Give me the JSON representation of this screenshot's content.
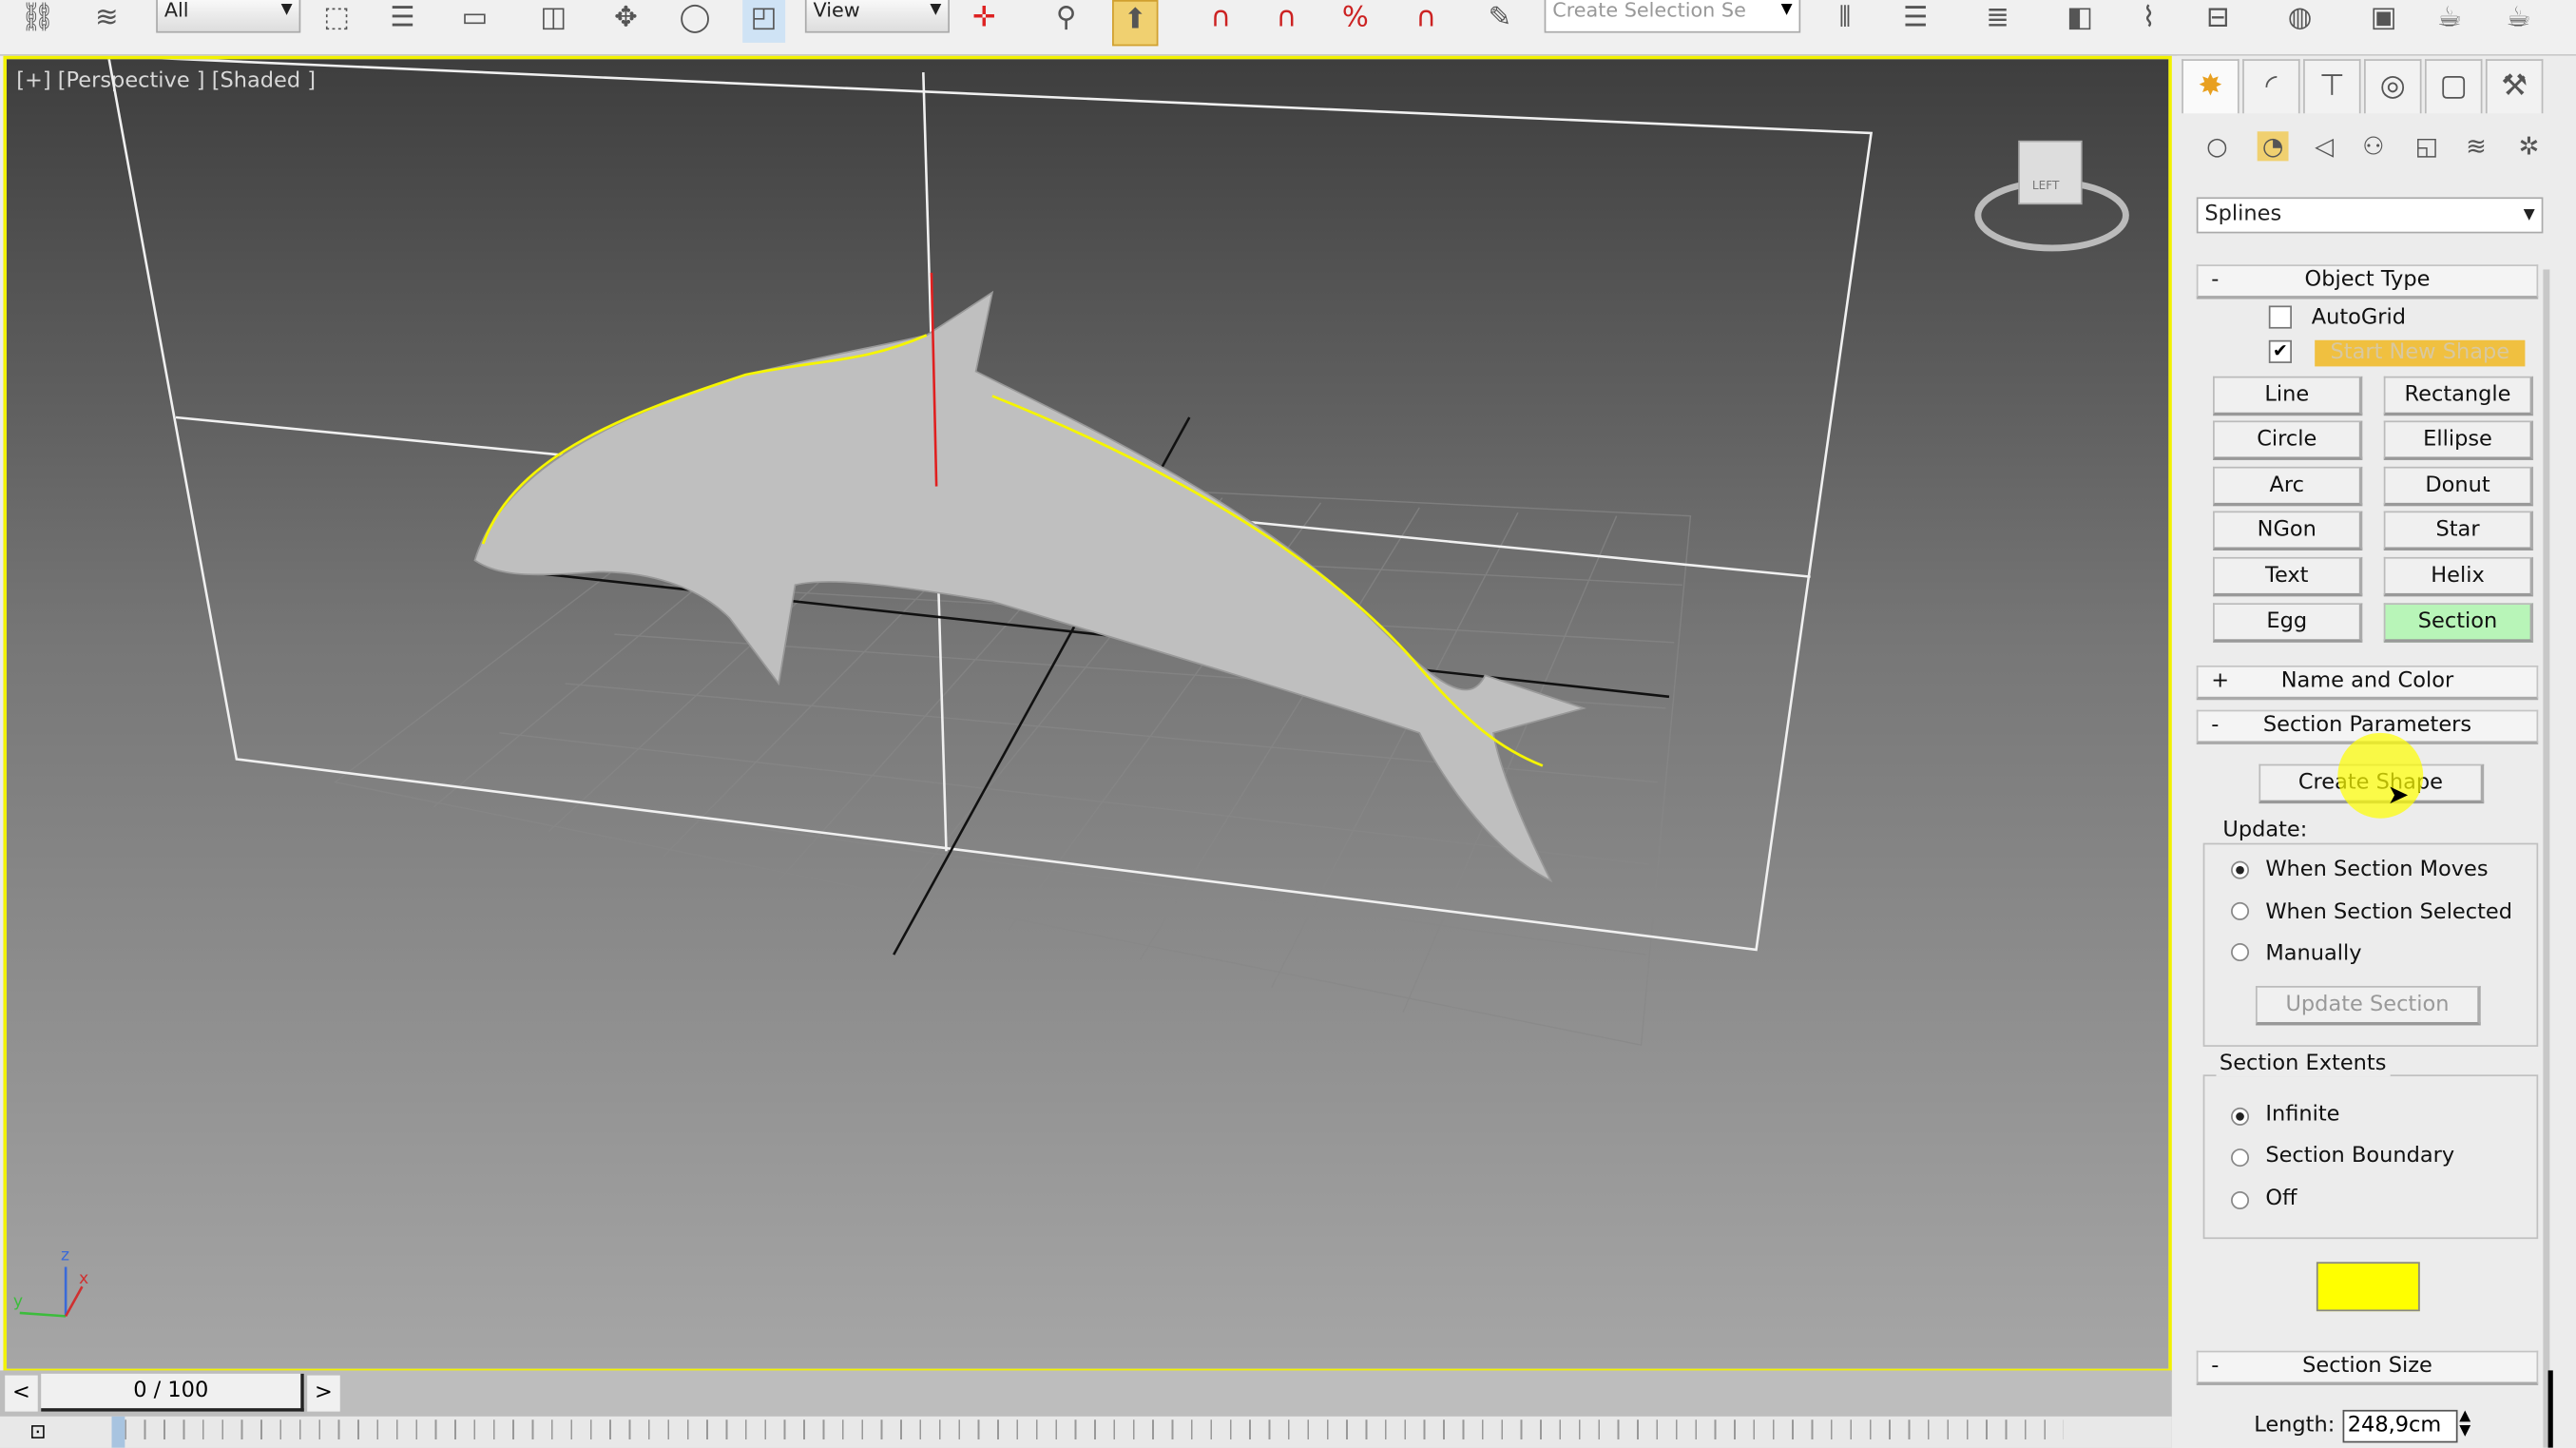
{
  "toolbar": {
    "selection_filter": "All",
    "reference_coord": "View",
    "named_selection_placeholder": "Create Selection Se"
  },
  "viewport": {
    "label": "[+] [Perspective ] [Shaded ]",
    "viewcube_face": "LEFT",
    "axis_x": "x",
    "axis_y": "y",
    "axis_z": "z"
  },
  "panel": {
    "category": "Splines",
    "object_type": {
      "title": "Object Type",
      "collapse": "-",
      "autogrid": "AutoGrid",
      "autogrid_checked": false,
      "start_new_shape": "Start New Shape",
      "start_new_shape_checked": true,
      "buttons": [
        "Line",
        "Rectangle",
        "Circle",
        "Ellipse",
        "Arc",
        "Donut",
        "NGon",
        "Star",
        "Text",
        "Helix",
        "Egg",
        "Section"
      ],
      "active": "Section"
    },
    "name_and_color": {
      "title": "Name and Color",
      "expand": "+"
    },
    "section_parameters": {
      "title": "Section Parameters",
      "collapse": "-",
      "create_shape": "Create Shape",
      "update_label": "Update:",
      "update_options": [
        "When Section Moves",
        "When Section Selected",
        "Manually"
      ],
      "update_selected": "When Section Moves",
      "update_section": "Update Section",
      "extents_label": "Section Extents",
      "extents_options": [
        "Infinite",
        "Section Boundary",
        "Off"
      ],
      "extents_selected": "Infinite",
      "section_color": "#ffff00"
    },
    "section_size": {
      "title": "Section Size",
      "collapse": "-",
      "length_label": "Length:",
      "length_value": "248,9cm"
    }
  },
  "timeline": {
    "prev": "<",
    "frame": "0 / 100",
    "next": ">"
  },
  "colors": {
    "active_viewport_border": "#f2f200",
    "active_button": "#b8f5b8",
    "start_new_shape": "#f0c040"
  }
}
